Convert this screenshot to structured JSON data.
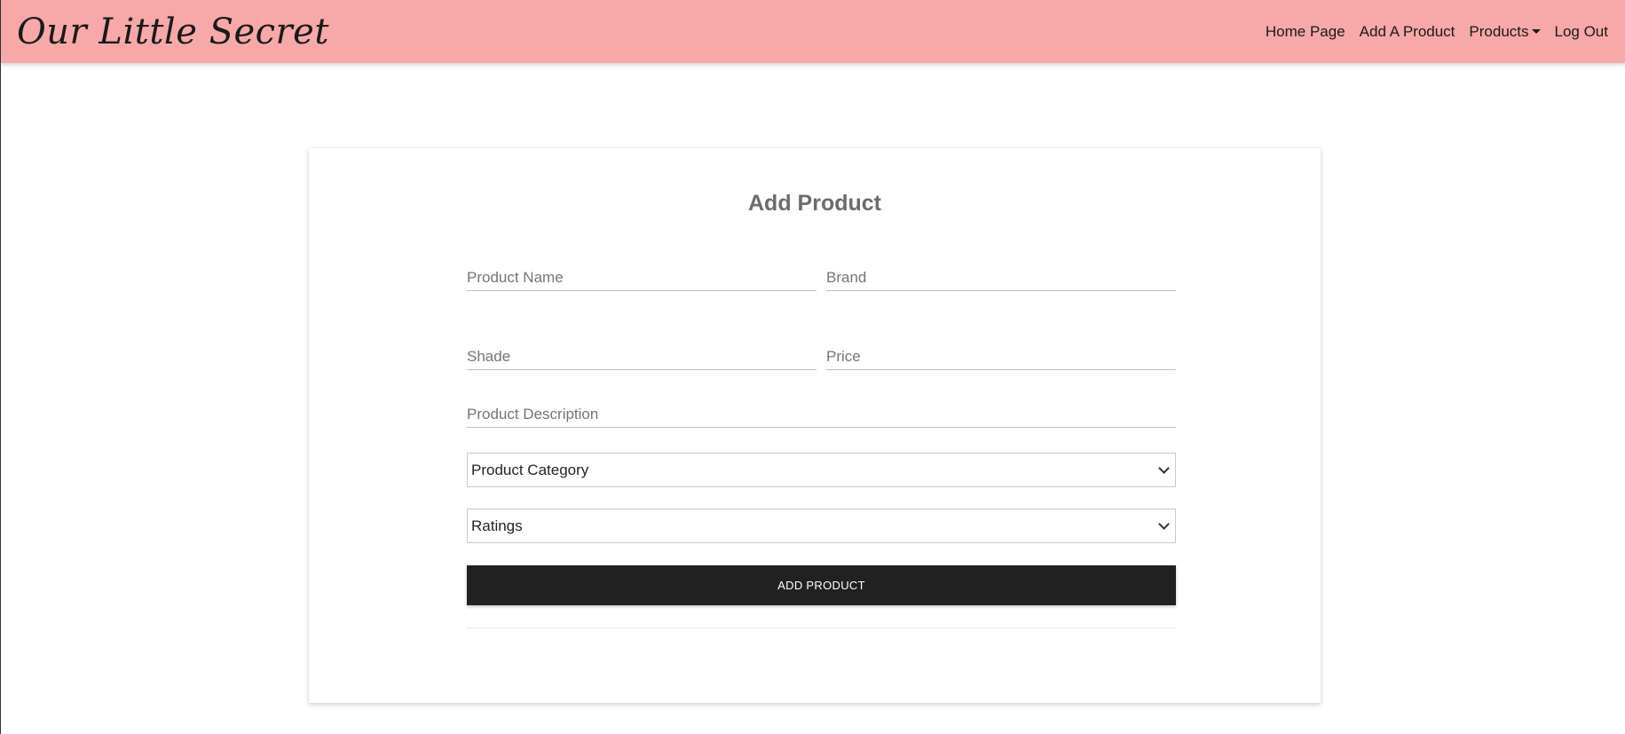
{
  "header": {
    "brand": "Our Little Secret",
    "nav": {
      "home": "Home Page",
      "add_product": "Add A Product",
      "products": "Products",
      "logout": "Log Out"
    }
  },
  "form": {
    "title": "Add Product",
    "product_name_placeholder": "Product Name",
    "brand_placeholder": "Brand",
    "shade_placeholder": "Shade",
    "price_placeholder": "Price",
    "description_placeholder": "Product Description",
    "category_selected": "Product Category",
    "ratings_selected": "Ratings",
    "submit_label": "ADD PRODUCT"
  },
  "colors": {
    "navbar": "#f7a8a8",
    "button": "#212121"
  }
}
